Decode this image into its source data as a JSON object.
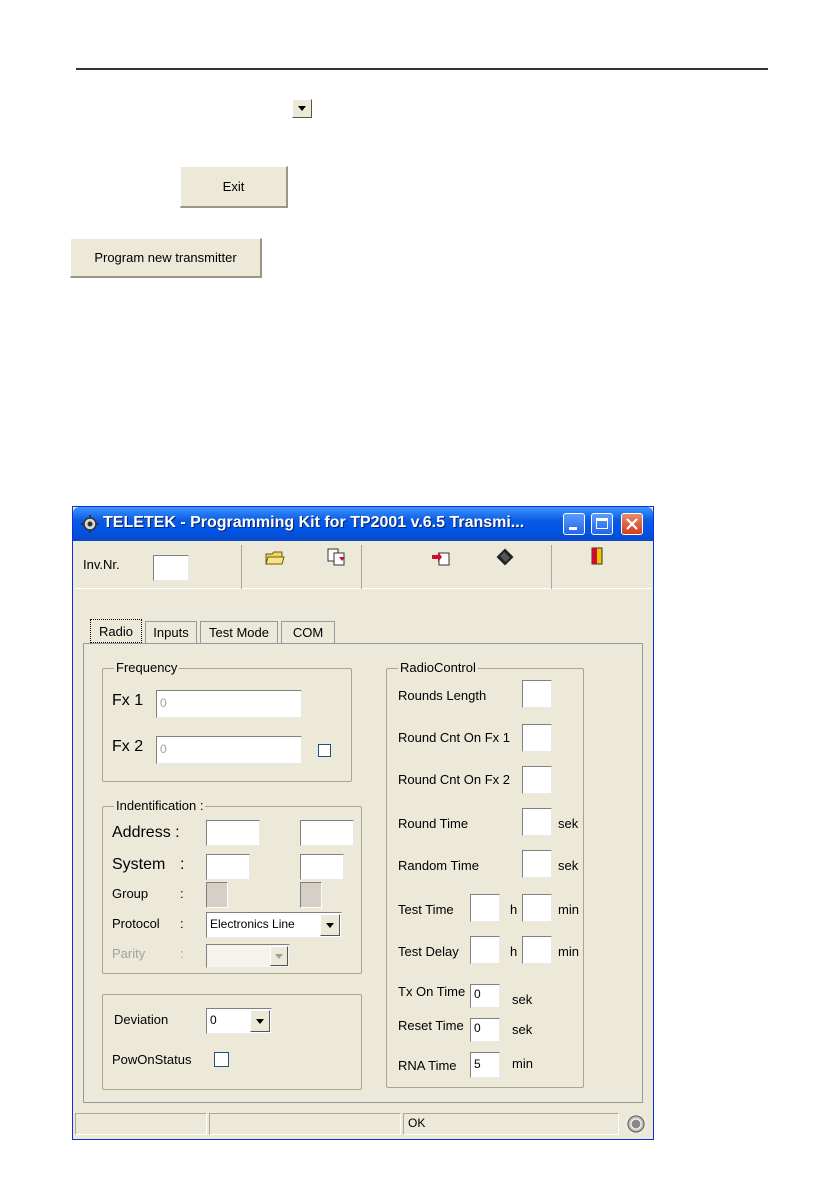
{
  "doc": {
    "exit_button": "Exit",
    "program_button": "Program new transmitter"
  },
  "window": {
    "title": "TELETEK - Programming Kit for TP2001 v.6.5 Transmi...",
    "inv_label": "Inv.Nr.",
    "tabs": [
      "Radio",
      "Inputs",
      "Test Mode",
      "COM"
    ],
    "frequency": {
      "legend": "Frequency",
      "fx1_label": "Fx 1",
      "fx1_value": "0",
      "fx2_label": "Fx 2",
      "fx2_value": "0"
    },
    "identification": {
      "legend": "Indentification :",
      "address_label": "Address :",
      "system_label": "System",
      "system_colon": ":",
      "group_label": "Group",
      "group_colon": ":",
      "protocol_label": "Protocol",
      "protocol_colon": ":",
      "protocol_value": "Electronics Line",
      "parity_label": "Parity",
      "parity_colon": ":"
    },
    "misc": {
      "deviation_label": "Deviation",
      "deviation_value": "0",
      "powon_label": "PowOnStatus"
    },
    "radio_control": {
      "legend": "RadioControl",
      "rounds_length": "Rounds Length",
      "round_cnt_fx1": "Round Cnt On Fx 1",
      "round_cnt_fx2": "Round Cnt On Fx 2",
      "round_time": "Round Time",
      "random_time": "Random Time",
      "test_time": "Test Time",
      "test_delay": "Test Delay",
      "tx_on_time": "Tx On Time",
      "tx_on_value": "0",
      "reset_time": "Reset Time",
      "reset_value": "0",
      "rna_time": "RNA Time",
      "rna_value": "5",
      "unit_sek": "sek",
      "unit_h": "h",
      "unit_min": "min"
    },
    "status": {
      "cell3": "OK"
    }
  },
  "colors": {
    "window_bg": "#ece9d8",
    "titlebar": "#0055e5",
    "close_button": "#e0462a"
  }
}
